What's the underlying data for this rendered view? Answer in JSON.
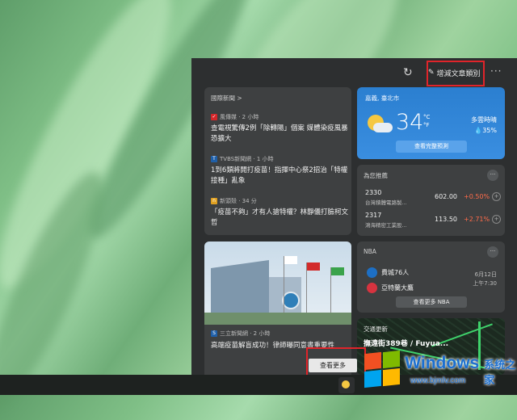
{
  "toolbar": {
    "refresh_icon": "refresh-icon",
    "edit_label": "增減文章類別",
    "more_label": "···"
  },
  "news_card": {
    "header": "國際新聞 >",
    "items": [
      {
        "source": "風傳媒 · 2 小時",
        "title": "查電視驚傳2例「除轉陽」個案 媒體染疫風暴恐擴大"
      },
      {
        "source": "TVBS新聞網 · 1 小時",
        "title": "1到6類將開打疫苗！指揮中心祭2招治「特權接種」亂象"
      },
      {
        "source": "新頭殼 · 34 分",
        "title": "「疫苗不夠」才有人搶特權？林靜儀打臉柯文哲"
      }
    ]
  },
  "weather": {
    "location": "嘉義, 臺北市",
    "temp": "34",
    "unit_c": "°C",
    "unit_f": "°F",
    "condition": "多雲時晴",
    "humidity": "35%",
    "button": "查看完整預測",
    "accent": "#2b7fd0"
  },
  "stocks": {
    "header": "為您推薦",
    "rows": [
      {
        "code": "2330",
        "name": "台灣積體電路製...",
        "price": "602.00",
        "change": "+0.50%"
      },
      {
        "code": "2317",
        "name": "鴻海精密工業股...",
        "price": "113.50",
        "change": "+2.71%"
      }
    ],
    "up_color": "#ff6b4a"
  },
  "photo_story": {
    "source": "三立新聞網 · 2 小時",
    "title": "高端疫苗解盲成功！律師曝同意書重要性"
  },
  "nba": {
    "header": "NBA",
    "team1": "費城76人",
    "team2": "亞特蘭大鷹",
    "date": "6月12日",
    "time": "上午7:30",
    "button": "查看更多 NBA"
  },
  "traffic": {
    "header": "交通更新",
    "title": "撫遠街389巷 / Fuyua..."
  },
  "see_more": "查看更多",
  "watermark": {
    "windows": "Windows",
    "cn": "系统之家",
    "url": "www.bjmlv.com"
  }
}
